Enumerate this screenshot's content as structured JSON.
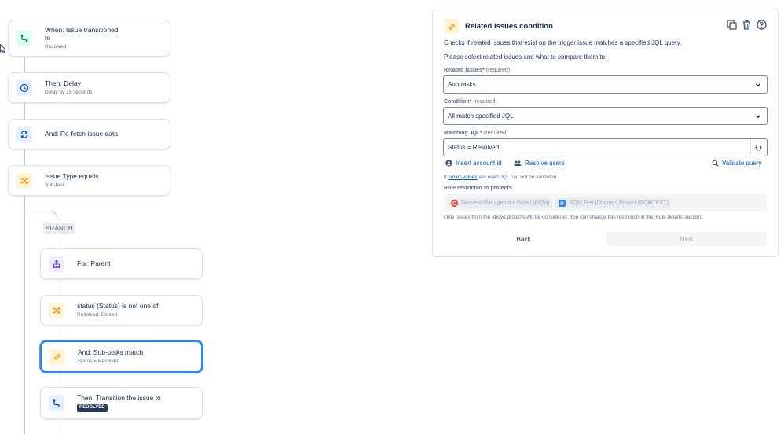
{
  "rule": {
    "trigger": {
      "title": "When: Issue transitioned",
      "line2": "to",
      "detail": "Resolved"
    },
    "delay": {
      "title": "Then: Delay",
      "detail": "Delay by 15 seconds"
    },
    "refetch": {
      "title": "And: Re-fetch issue data"
    },
    "issue_type": {
      "title": "Issue Type equals",
      "detail": "Sub-task"
    },
    "branch_label": "BRANCH",
    "for_parent": {
      "title": "For: Parent"
    },
    "status_check": {
      "title": "status (Status) is not one of",
      "detail": "Resolved, Closed"
    },
    "subtasks_match": {
      "title": "And: Sub-tasks match",
      "detail": "Status = Resolved"
    },
    "transition": {
      "title": "Then: Transition the issue to",
      "badge": "RESOLVED"
    }
  },
  "panel": {
    "title": "Related issues condition",
    "description": "Checks if related issues that exist on the trigger issue matches a specified JQL query.",
    "prompt": "Please select related issues and what to compare them to:",
    "related_issues": {
      "label": "Related issues",
      "required_text": "(required)",
      "value": "Sub-tasks"
    },
    "condition": {
      "label": "Condition",
      "required_text": "(required)",
      "value": "All match specified JQL"
    },
    "matching_jql": {
      "label": "Matching JQL",
      "required_text": "(required)",
      "value": "Status = Resolved",
      "braces": "{}"
    },
    "links": {
      "insert_account": "Insert account id",
      "resolve_users": "Resolve users",
      "validate": "Validate query"
    },
    "smart_note": {
      "prefix": "If",
      "link": "smart-values",
      "suffix": "are used JQL can not be validated."
    },
    "restricted_label": "Rule restricted to projects",
    "projects": [
      {
        "name": "Request Management (New) (RQM)",
        "color": "#e5493a"
      },
      {
        "name": "RQM Test (Dummy) Project (RQMTEST)",
        "color": "#2684ff"
      }
    ],
    "restriction_note": "Only issues from the above projects will be considered. You can change this restriction in the 'Rule details' section.",
    "back_label": "Back",
    "next_label": "Next"
  },
  "icons": {
    "trigger": "transition-icon",
    "delay": "clock-icon",
    "refetch": "refresh-icon",
    "condition": "shuffle-icon",
    "branch": "hierarchy-icon",
    "related": "link-icon",
    "duplicate": "copy-icon",
    "delete": "trash-icon",
    "help": "question-icon"
  },
  "colors": {
    "accent": "#0052cc",
    "selected_border": "#2684ff",
    "required": "#de350b"
  }
}
